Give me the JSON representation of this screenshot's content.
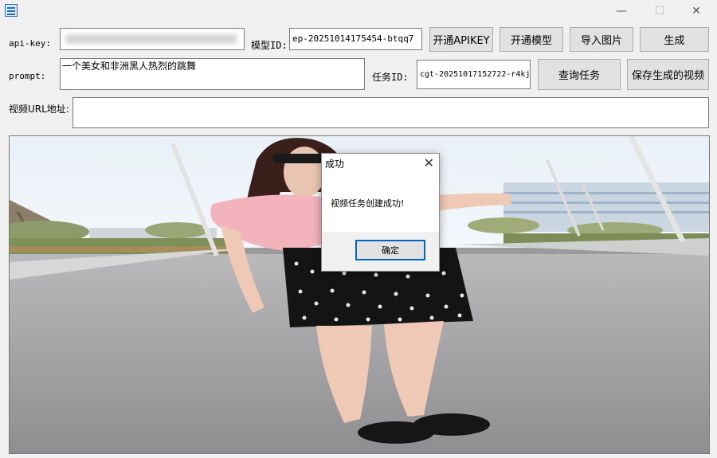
{
  "window": {
    "controls": {
      "minimize": "—",
      "maximize": "☐",
      "close": "✕"
    }
  },
  "form": {
    "api_key_label": "api-key:",
    "model_id_label": "模型ID:",
    "model_id_value": "ep-20251014175454-btqq7",
    "prompt_label": "prompt:",
    "prompt_value": "一个美女和非洲黑人热烈的跳舞",
    "task_id_label": "任务ID:",
    "task_id_value": "cgt-20251017152722-r4kj",
    "video_url_label": "视频URL地址:",
    "video_url_value": ""
  },
  "buttons": {
    "open_apikey": "开通APIKEY",
    "open_model": "开通模型",
    "import_image": "导入图片",
    "generate": "生成",
    "query_task": "查询任务",
    "save_video": "保存生成的视频"
  },
  "dialog": {
    "title": "成功",
    "close": "✕",
    "message": "视频任务创建成功!",
    "ok": "确定"
  },
  "colors": {
    "window_bg": "#f0f0f0",
    "dialog_ok_border": "#0067c0"
  }
}
